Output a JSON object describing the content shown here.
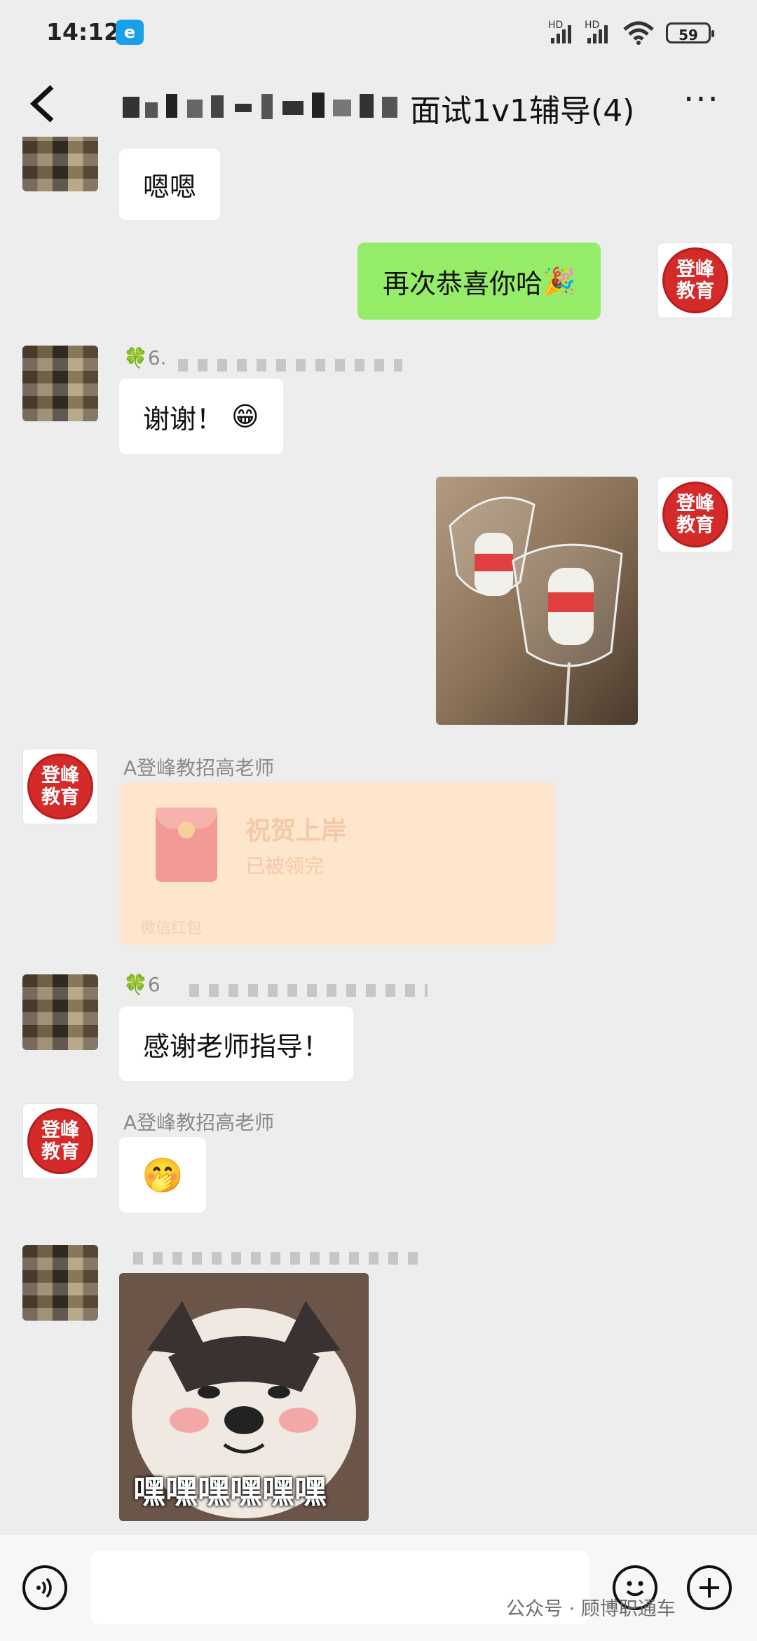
{
  "status_bar": {
    "time": "14:12",
    "app_badge": "e",
    "signal1": "HD",
    "signal2": "HD",
    "battery": "59"
  },
  "header": {
    "back_icon": "<",
    "title": "面试1v1辅导(4)",
    "more_icon": "···"
  },
  "messages": {
    "m1_text": "嗯嗯",
    "m2_text": "再次恭喜你哈",
    "m2_emoji": "🎉",
    "m3_nick_prefix": "🍀6.",
    "m3_text": "谢谢！",
    "m3_emoji": "😁",
    "m5_nick": "A登峰教招高老师",
    "m5_packet_title": "祝贺上岸",
    "m5_packet_status": "已被领完",
    "m5_packet_footer": "微信红包",
    "m6_nick_prefix": "🍀6",
    "m6_text": "感谢老师指导！",
    "m7_nick": "A登峰教招高老师",
    "m7_emoji": "🤭",
    "m8_sticker_text": "嘿嘿嘿嘿嘿嘿"
  },
  "brand_avatar": {
    "line1": "登峰",
    "line2": "教育"
  },
  "bottom_bar": {
    "voice_icon": "voice-icon",
    "emoji_icon": "😀",
    "plus_icon": "+"
  },
  "watermark": {
    "text": "公众号 · 顾博职通车"
  },
  "colors": {
    "background": "#ededed",
    "my_bubble": "#95ec69",
    "other_bubble": "#ffffff",
    "brand_red": "#d42a2a",
    "red_packet": "#fde6cc"
  }
}
